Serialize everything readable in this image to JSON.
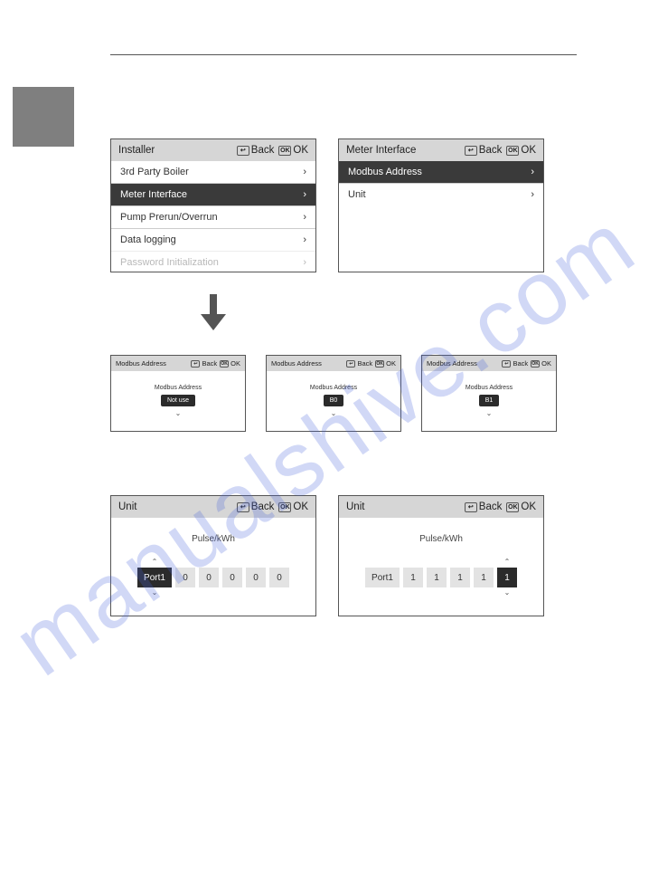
{
  "ui": {
    "back_label": "Back",
    "ok_label": "OK",
    "back_glyph": "↩",
    "ok_glyph": "OK"
  },
  "installer": {
    "title": "Installer",
    "items": [
      {
        "label": "3rd Party Boiler",
        "selected": false
      },
      {
        "label": "Meter Interface",
        "selected": true
      },
      {
        "label": "Pump Prerun/Overrun",
        "selected": false
      },
      {
        "label": "Data logging",
        "selected": false
      },
      {
        "label": "Password Initialization",
        "selected": false
      }
    ]
  },
  "meter_interface": {
    "title": "Meter Interface",
    "items": [
      {
        "label": "Modbus Address",
        "selected": true
      },
      {
        "label": "Unit",
        "selected": false
      }
    ]
  },
  "modbus": {
    "title": "Modbus Address",
    "field_label": "Modbus Address",
    "values": [
      "Not use",
      "B0",
      "B1"
    ]
  },
  "unit_panel": {
    "title": "Unit",
    "label": "Pulse/kWh",
    "port_label": "Port1",
    "left": {
      "selected_index": 0,
      "digits": [
        "0",
        "0",
        "0",
        "0",
        "0"
      ]
    },
    "right": {
      "selected_index": 5,
      "digits": [
        "1",
        "1",
        "1",
        "1",
        "1"
      ]
    }
  },
  "watermark": "manualshive.com"
}
